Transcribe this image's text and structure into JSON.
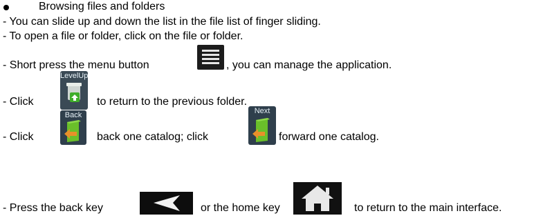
{
  "section": {
    "heading": "Browsing files and folders",
    "lines": [
      "- You can slide up and down the list in the file list of finger sliding.",
      "- To open a file or folder, click on the file or folder."
    ]
  },
  "menu_line": {
    "before": "- Short press the menu button",
    "after": ", you can manage the application."
  },
  "levelup_line": {
    "before": "- Click",
    "after": "to return to the previous folder.",
    "icon_label": "LevelUp"
  },
  "backnext_line": {
    "before": "- Click",
    "middle": "back one catalog; click",
    "after": "forward one catalog.",
    "back_icon_label": "Back",
    "next_icon_label": "Next"
  },
  "keys_line": {
    "before": "- Press the back key",
    "middle": "or the home key",
    "after": "to return to the main interface."
  },
  "icons": {
    "menu": "menu-icon",
    "levelup": "level-up-icon",
    "back": "back-icon",
    "next": "next-icon",
    "back_key": "back-arrow-icon",
    "home_key": "home-icon"
  },
  "colors": {
    "icon_dark": "#1c1c1c",
    "folder_green": "#6abf2a",
    "arrow_orange": "#e8902a"
  }
}
